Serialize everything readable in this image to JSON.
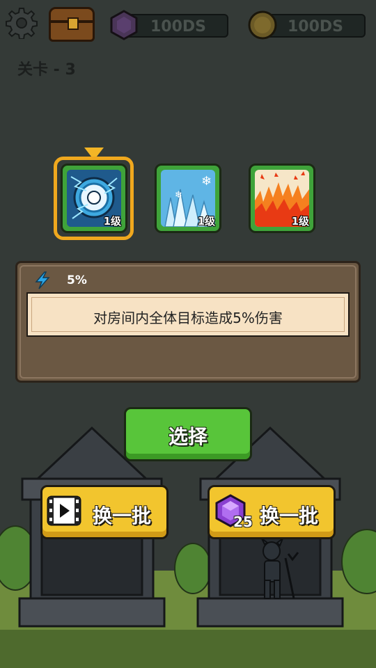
{
  "header": {
    "gems_value": "100DS",
    "coins_value": "100DS",
    "level_label": "关卡 - 3"
  },
  "skills": [
    {
      "name": "lightning",
      "level_label": "1级",
      "selected": true
    },
    {
      "name": "ice",
      "level_label": "1级",
      "selected": false
    },
    {
      "name": "fire",
      "level_label": "1级",
      "selected": false
    }
  ],
  "detail": {
    "percent": "5%",
    "description": "对房间内全体目标造成5%伤害"
  },
  "buttons": {
    "select_label": "选择",
    "refresh_video_label": "换一批",
    "refresh_gem_label": "换一批",
    "refresh_gem_cost": "25"
  },
  "colors": {
    "select_green": "#58c53a",
    "refresh_yellow": "#f2c52e",
    "selected_frame": "#f0a81e"
  }
}
